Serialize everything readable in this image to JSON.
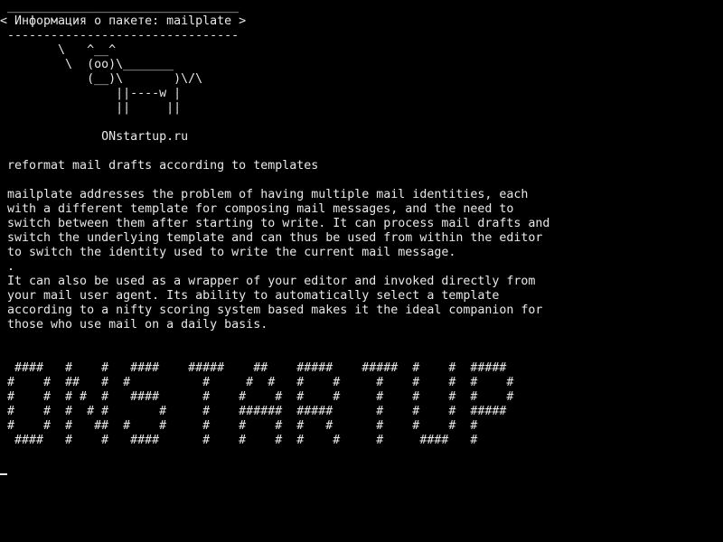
{
  "terminal": {
    "bubble_top": " ________________________________",
    "bubble_title": "< Информация о пакете: mailplate >",
    "bubble_bottom": " --------------------------------",
    "cow": [
      "        \\   ^__^",
      "         \\  (oo)\\_______",
      "            (__)\\       )\\/\\",
      "                ||----w |",
      "                ||     ||"
    ],
    "site": "              ONstartup.ru",
    "summary": " reformat mail drafts according to templates",
    "description": [
      " mailplate addresses the problem of having multiple mail identities, each",
      " with a different template for composing mail messages, and the need to",
      " switch between them after starting to write. It can process mail drafts and",
      " switch the underlying template and can thus be used from within the editor",
      " to switch the identity used to write the current mail message.",
      " .",
      " It can also be used as a wrapper of your editor and invoked directly from",
      " your mail user agent. Its ability to automatically select a template",
      " according to a nifty scoring system based makes it the ideal companion for",
      " those who use mail on a daily basis."
    ],
    "banner": [
      "  ####   #    #   ####    #####    ##    #####    #####  #    #  #####",
      " #    #  ##   #  #          #     #  #   #    #     #    #    #  #    #",
      " #    #  # #  #   ####      #    #    #  #    #     #    #    #  #    #",
      " #    #  #  # #       #     #    ######  #####      #    #    #  #####",
      " #    #  #   ##  #    #     #    #    #  #   #      #    #    #  #",
      "  ####   #    #   ####      #    #    #  #    #     #     ####   #"
    ]
  }
}
